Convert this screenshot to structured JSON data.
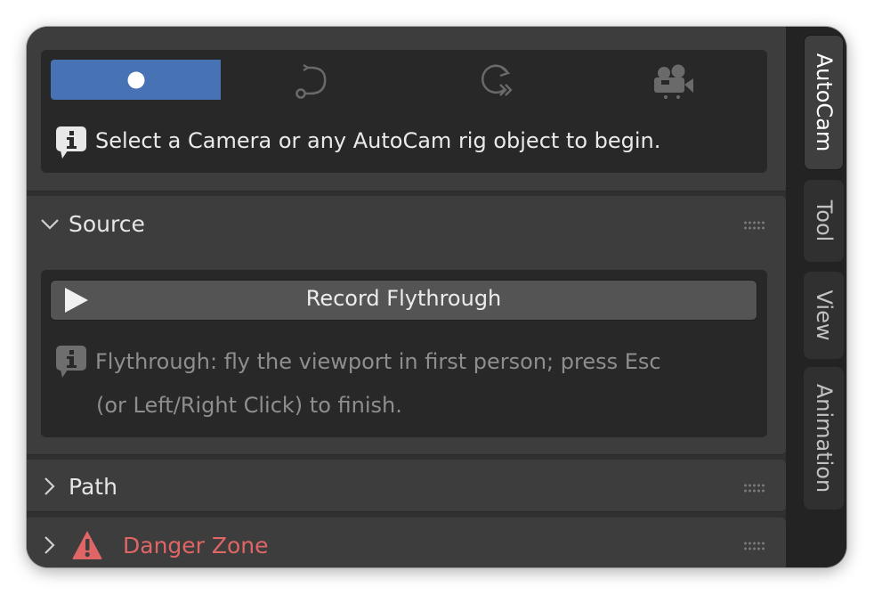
{
  "header_panel": {
    "mode_tabs": [
      {
        "icon": "dot-icon",
        "active": true
      },
      {
        "icon": "path-curve-icon",
        "active": false
      },
      {
        "icon": "orbit-icon",
        "active": false
      },
      {
        "icon": "camera-icon",
        "active": false
      }
    ],
    "info_text": "Select a Camera or any AutoCam rig object to begin."
  },
  "source_panel": {
    "title": "Source",
    "expanded": true,
    "record_button_label": "Record Flythrough",
    "hint_line1": "Flythrough: fly the viewport in first person; press Esc",
    "hint_line2": "(or Left/Right Click) to finish."
  },
  "path_panel": {
    "title": "Path",
    "expanded": false
  },
  "danger_panel": {
    "title": "Danger Zone",
    "expanded": false,
    "title_color": "#e06666"
  },
  "sidebar_tabs": [
    {
      "label": "AutoCam",
      "active": true
    },
    {
      "label": "Tool",
      "active": false
    },
    {
      "label": "View",
      "active": false
    },
    {
      "label": "Animation",
      "active": false
    }
  ],
  "colors": {
    "accent": "#4772b3",
    "danger": "#e06666"
  }
}
